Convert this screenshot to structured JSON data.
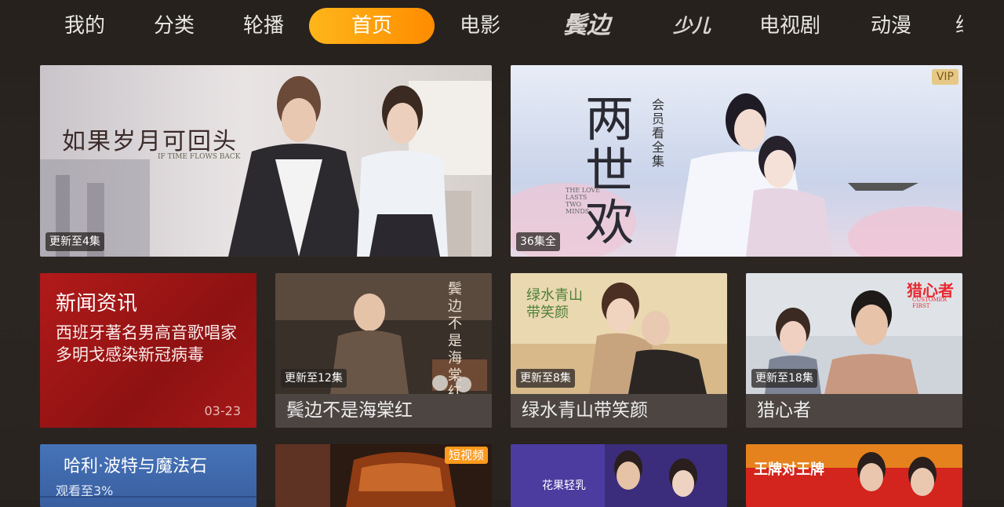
{
  "nav": {
    "tabs": [
      {
        "label": "我的"
      },
      {
        "label": "分类"
      },
      {
        "label": "轮播"
      },
      {
        "label": "首页",
        "active": true
      },
      {
        "label": "电影"
      },
      {
        "label": "鬓边"
      },
      {
        "label": "少儿"
      },
      {
        "label": "电视剧"
      },
      {
        "label": "动漫"
      },
      {
        "label": "综"
      }
    ]
  },
  "featured": [
    {
      "title": "如果岁月可回头",
      "subtitle": "IF TIME FLOWS BACK",
      "badge": "更新至4集"
    },
    {
      "title": "两世欢",
      "subtitle": "THE LOVE LASTS TWO MINDS",
      "tag": "会员看全集",
      "badge": "36集全",
      "vip": "VIP"
    }
  ],
  "news": {
    "title": "新闻资讯",
    "text": "西班牙著名男高音歌唱家多明戈感染新冠病毒",
    "date": "03-23"
  },
  "row2": [
    {
      "name": "鬓边不是海棠红",
      "badge": "更新至12集",
      "poster_title": "鬓边不是海棠红"
    },
    {
      "name": "绿水青山带笑颜",
      "badge": "更新至8集",
      "poster_title": "绿水青山带笑颜"
    },
    {
      "name": "猎心者",
      "badge": "更新至18集",
      "poster_title": "猎心者",
      "poster_sub": "CUSTOMER FIRST"
    }
  ],
  "row3": {
    "history": {
      "title": "哈利·波特与魔法石",
      "progress": "观看至3%"
    },
    "short_video": {
      "tag": "短视频"
    },
    "show1": {
      "text": "花果轻乳"
    },
    "show2": {
      "text": "王牌对王牌"
    }
  }
}
